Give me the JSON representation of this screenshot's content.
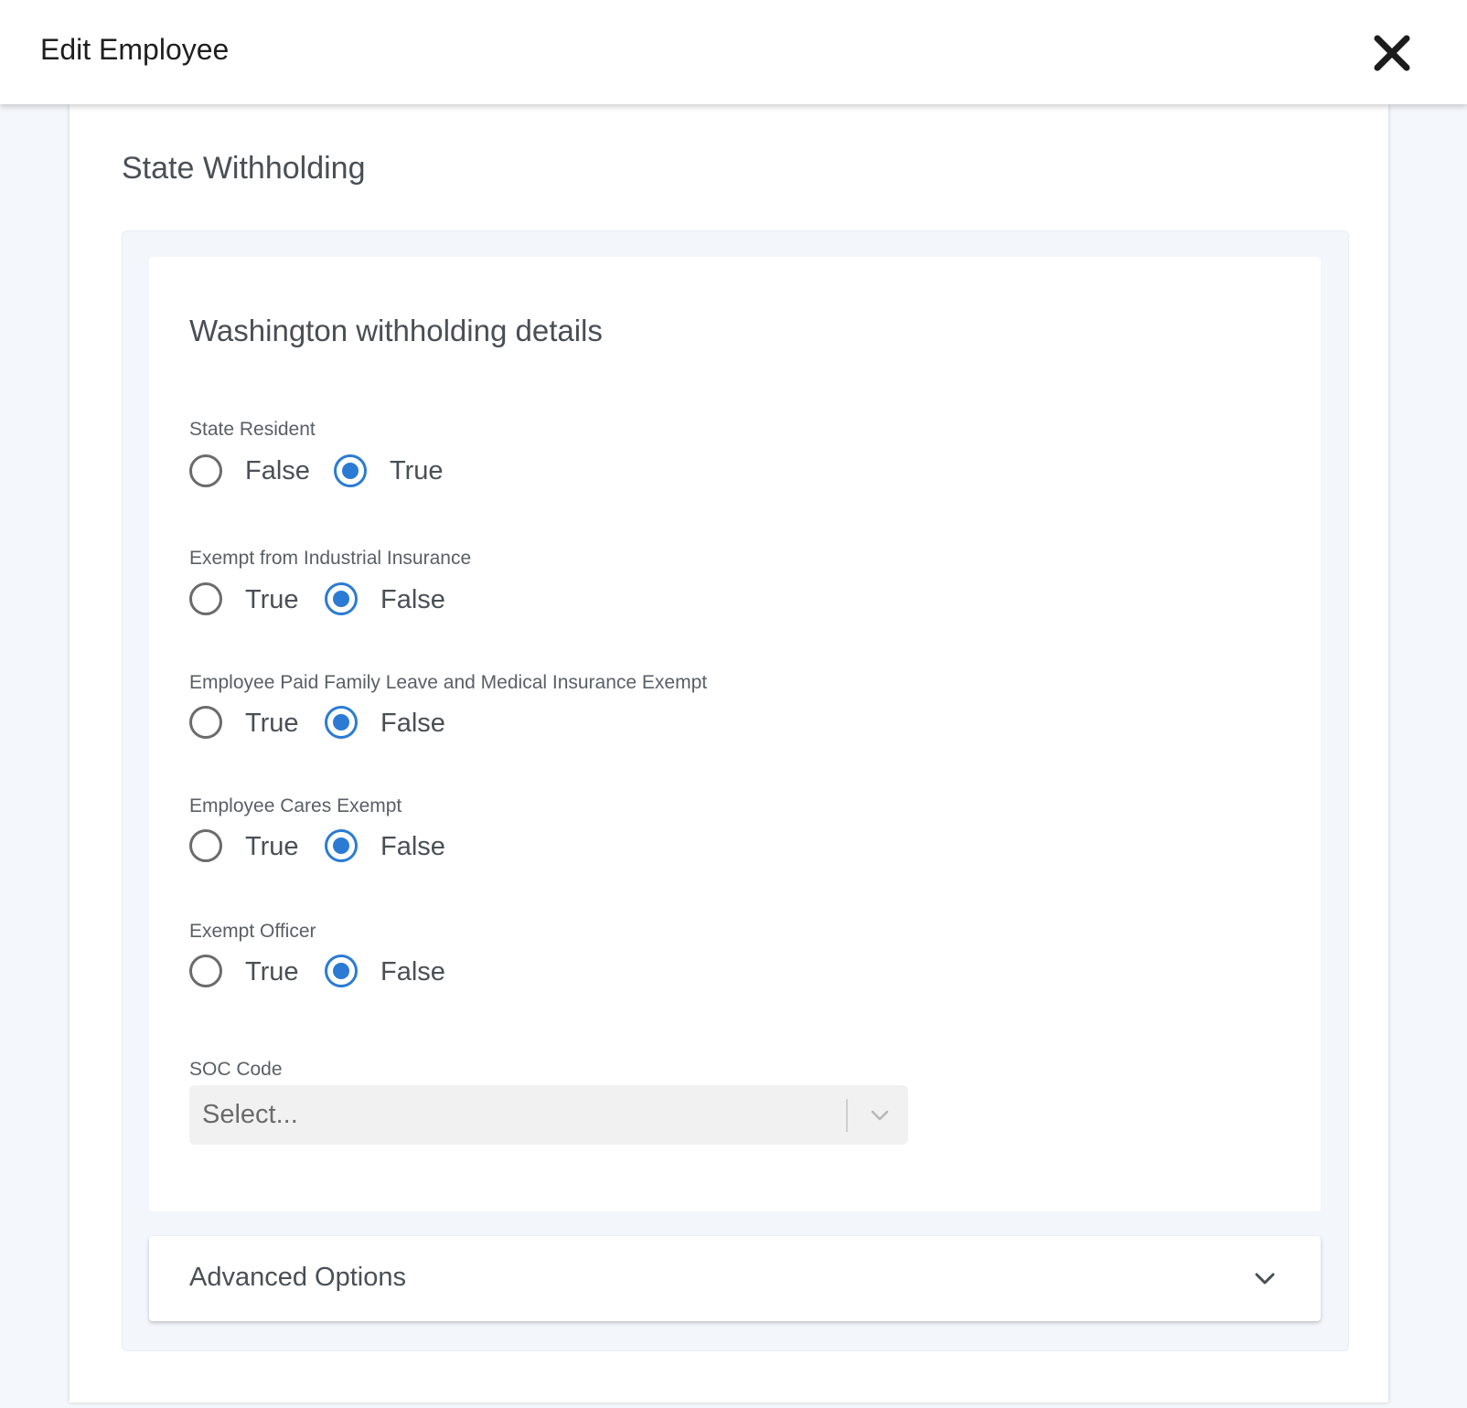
{
  "header": {
    "title": "Edit Employee",
    "close_icon": "close-icon"
  },
  "section": {
    "title": "State Withholding"
  },
  "card": {
    "title": "Washington withholding details"
  },
  "fields": [
    {
      "label": "State Resident",
      "options": [
        "False",
        "True"
      ],
      "selected": "True"
    },
    {
      "label": "Exempt from Industrial Insurance",
      "options": [
        "True",
        "False"
      ],
      "selected": "False"
    },
    {
      "label": "Employee Paid Family Leave and Medical Insurance Exempt",
      "options": [
        "True",
        "False"
      ],
      "selected": "False"
    },
    {
      "label": "Employee Cares Exempt",
      "options": [
        "True",
        "False"
      ],
      "selected": "False"
    },
    {
      "label": "Exempt Officer",
      "options": [
        "True",
        "False"
      ],
      "selected": "False"
    }
  ],
  "soc": {
    "label": "SOC Code",
    "placeholder": "Select..."
  },
  "advanced": {
    "label": "Advanced Options"
  },
  "colors": {
    "accent": "#2b7bd4",
    "panel_bg": "#f3f7fc"
  }
}
